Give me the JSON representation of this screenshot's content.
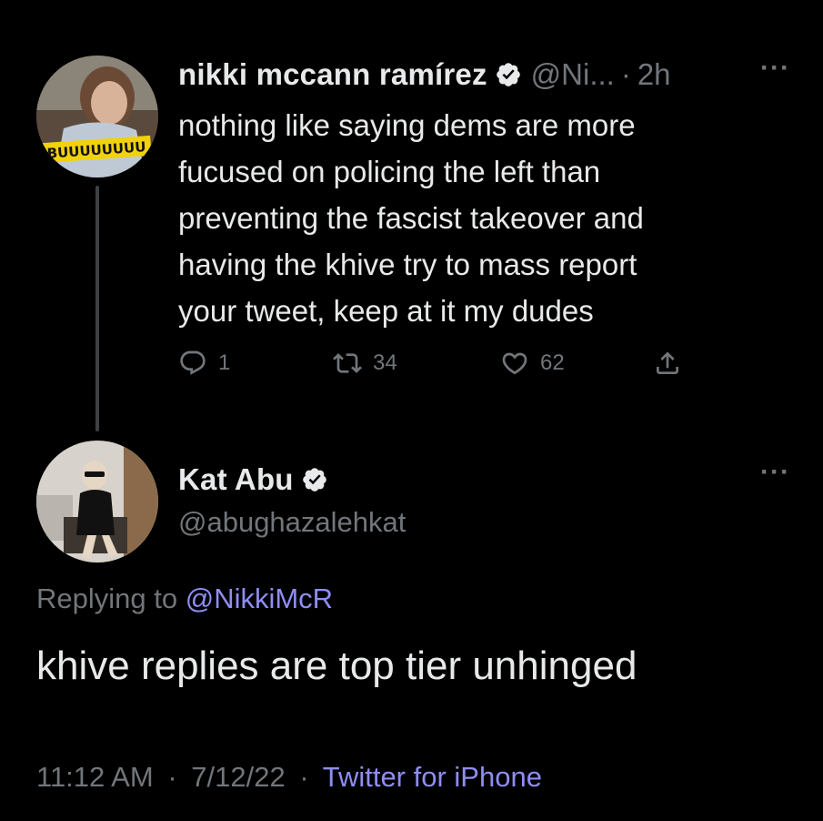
{
  "tweet": {
    "author": {
      "name": "nikki mccann ramírez",
      "handle": "@Ni...",
      "verified": true,
      "avatar_label": "BUUUUUUUU"
    },
    "time_ago": "2h",
    "separator": "·",
    "more": "···",
    "text_lines": [
      "nothing like saying dems are more",
      "fucused on policing the left than",
      "preventing the fascist takeover and",
      "having the khive try to mass report",
      "your tweet, keep at it my dudes"
    ],
    "stats": {
      "replies": "1",
      "retweets": "34",
      "likes": "62"
    }
  },
  "reply": {
    "author": {
      "name": "Kat Abu",
      "handle": "@abughazalehkat",
      "verified": true
    },
    "more": "···",
    "replying_prefix": "Replying to",
    "replying_to": "@NikkiMcR",
    "text": "khive replies are top tier unhinged",
    "time": "11:12 AM",
    "date": "7/12/22",
    "separator": "·",
    "source": "Twitter for iPhone"
  },
  "colors": {
    "background": "#000000",
    "text": "#e7e9ea",
    "muted": "#71767b",
    "link": "#8f8df2"
  }
}
